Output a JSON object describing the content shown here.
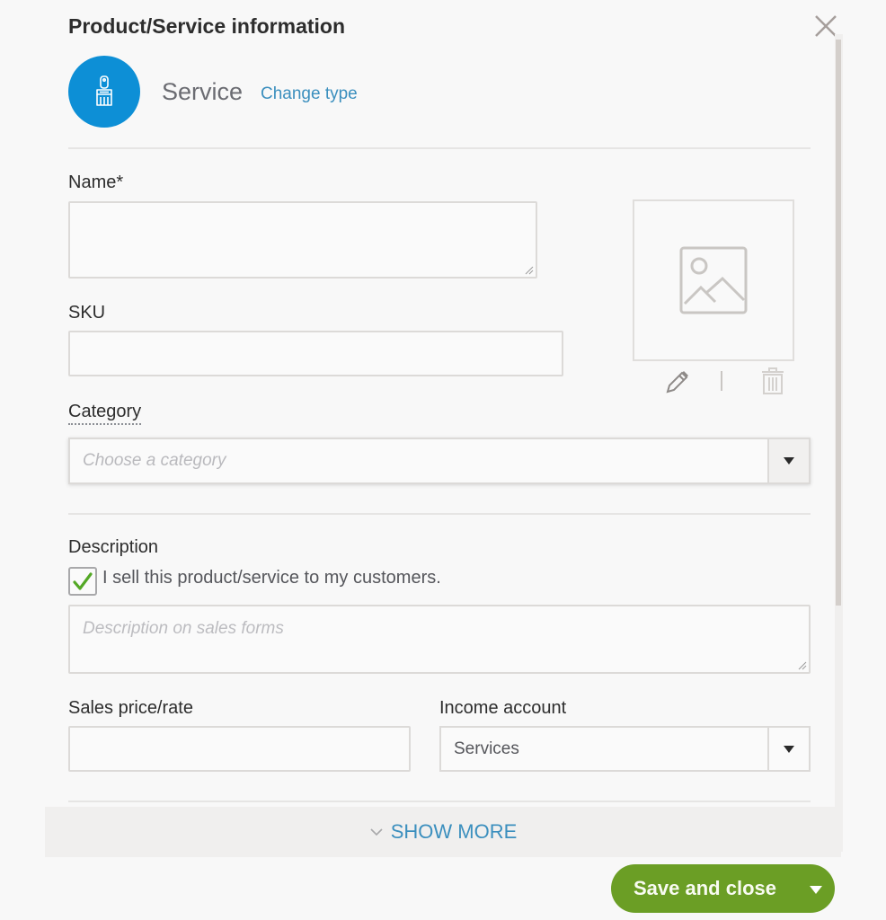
{
  "dialog": {
    "title": "Product/Service information",
    "type_label": "Service",
    "change_type_link": "Change type",
    "colors": {
      "accent_blue": "#0d8fd6",
      "link_blue": "#3b8fbe",
      "save_green": "#6b9e25"
    }
  },
  "form": {
    "name": {
      "label": "Name*",
      "value": ""
    },
    "sku": {
      "label": "SKU",
      "value": ""
    },
    "category": {
      "label": "Category",
      "placeholder": "Choose a category"
    },
    "description": {
      "label": "Description",
      "checkbox_label": "I sell this product/service to my customers.",
      "checkbox_checked": true,
      "placeholder": "Description on sales forms",
      "value": ""
    },
    "sales_price": {
      "label": "Sales price/rate",
      "value": ""
    },
    "income_account": {
      "label": "Income account",
      "value": "Services"
    }
  },
  "footer": {
    "show_more": "SHOW MORE",
    "save_button": "Save and close"
  }
}
